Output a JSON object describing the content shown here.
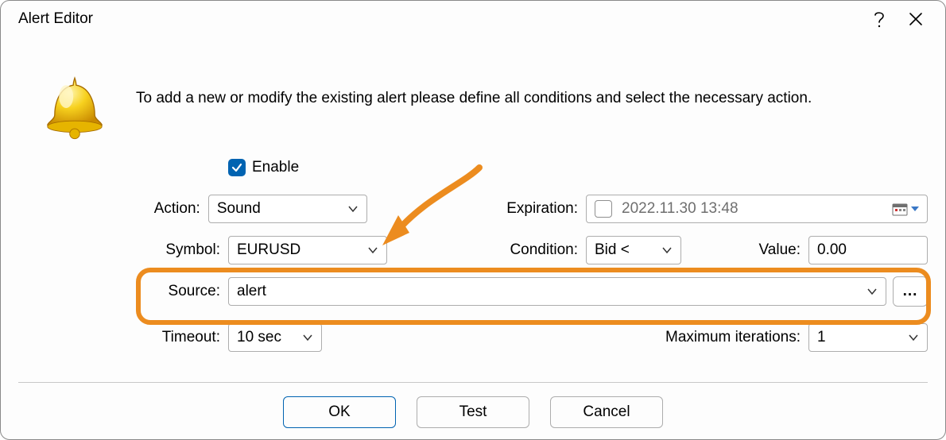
{
  "window": {
    "title": "Alert Editor"
  },
  "description": "To add a new or modify the existing alert please define all conditions and select the necessary action.",
  "form": {
    "enable_label": "Enable",
    "action_label": "Action:",
    "action_value": "Sound",
    "expiration_label": "Expiration:",
    "expiration_value": "2022.11.30 13:48",
    "symbol_label": "Symbol:",
    "symbol_value": "EURUSD",
    "condition_label": "Condition:",
    "condition_value": "Bid <",
    "value_label": "Value:",
    "value_value": "0.00",
    "source_label": "Source:",
    "source_value": "alert",
    "browse_label": "...",
    "timeout_label": "Timeout:",
    "timeout_value": "10 sec",
    "maxiter_label": "Maximum iterations:",
    "maxiter_value": "1"
  },
  "buttons": {
    "ok": "OK",
    "test": "Test",
    "cancel": "Cancel"
  }
}
